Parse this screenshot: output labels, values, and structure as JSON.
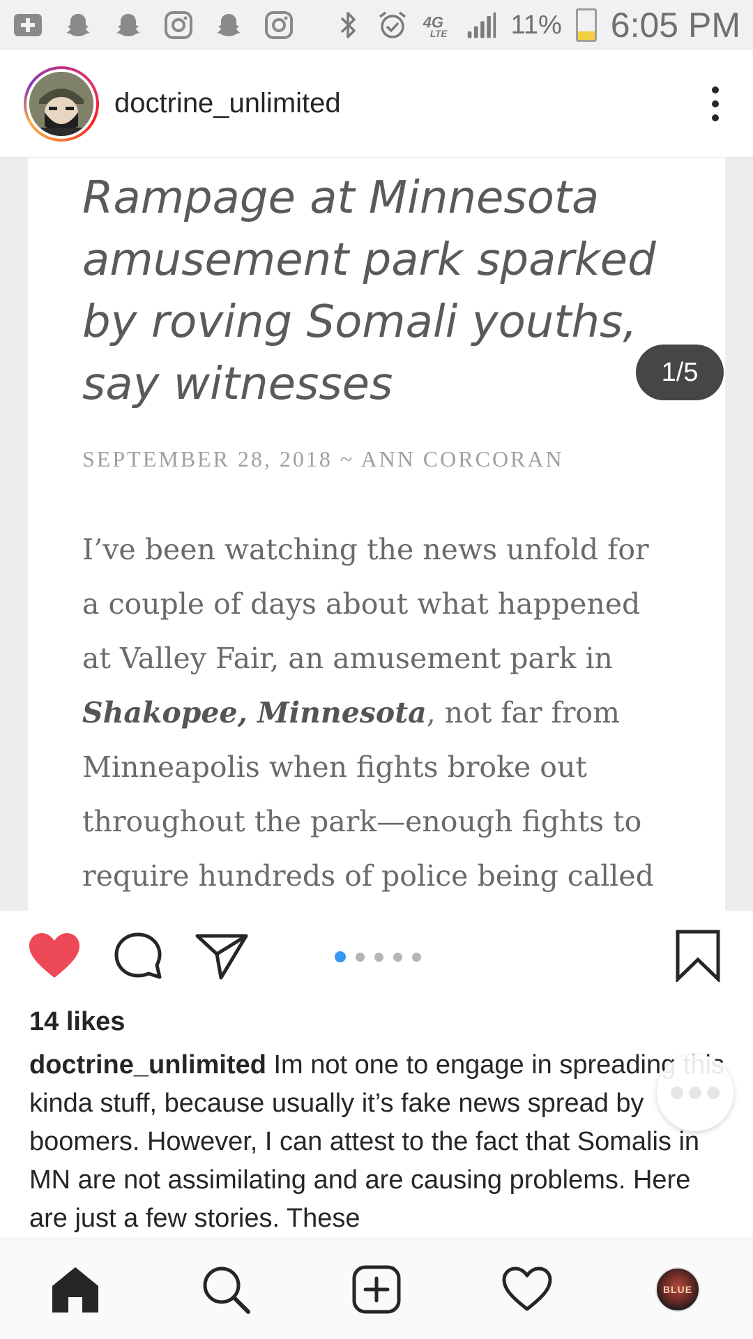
{
  "status_bar": {
    "icons": [
      "add-box-icon",
      "snapchat-icon",
      "snapchat-icon",
      "instagram-icon",
      "snapchat-icon",
      "instagram-icon"
    ],
    "right_icons": [
      "bluetooth-icon",
      "alarm-icon",
      "4g-lte-icon",
      "signal-icon"
    ],
    "battery_percent": "11%",
    "battery_level": 0.11,
    "time": "6:05 PM"
  },
  "header": {
    "username": "doctrine_unlimited"
  },
  "post": {
    "counter": "1/5",
    "article": {
      "title": "Rampage at Minnesota amusement park sparked by roving Somali youths, say witnesses",
      "meta": "SEPTEMBER 28, 2018 ~ ANN CORCORAN",
      "body_part1": "I’ve been watching the news unfold for a couple of days about what happened at Valley Fair, an amusement park in ",
      "body_bold": "Shakopee, Minnesota",
      "body_part2": ", not far from Minneapolis when fights broke out throughout the park—enough fights to require hundreds of police being called to"
    },
    "carousel": {
      "count": 5,
      "active_index": 0
    },
    "likes": "14 likes",
    "caption_user": "doctrine_unlimited",
    "caption_text": " Im not one to engage in spreading this kinda stuff, because usually it’s fake news spread by boomers. However, I can attest to the fact that Somalis in MN are not assimilating and are causing problems. Here are just a few stories. These"
  },
  "colors": {
    "like_red": "#ed4956",
    "accent_blue": "#3897f0",
    "text": "#262626"
  },
  "bottom_nav": {
    "items": [
      "home-icon",
      "search-icon",
      "new-post-icon",
      "activity-heart-icon",
      "profile-avatar"
    ],
    "profile_avatar_text": "BLUE"
  }
}
